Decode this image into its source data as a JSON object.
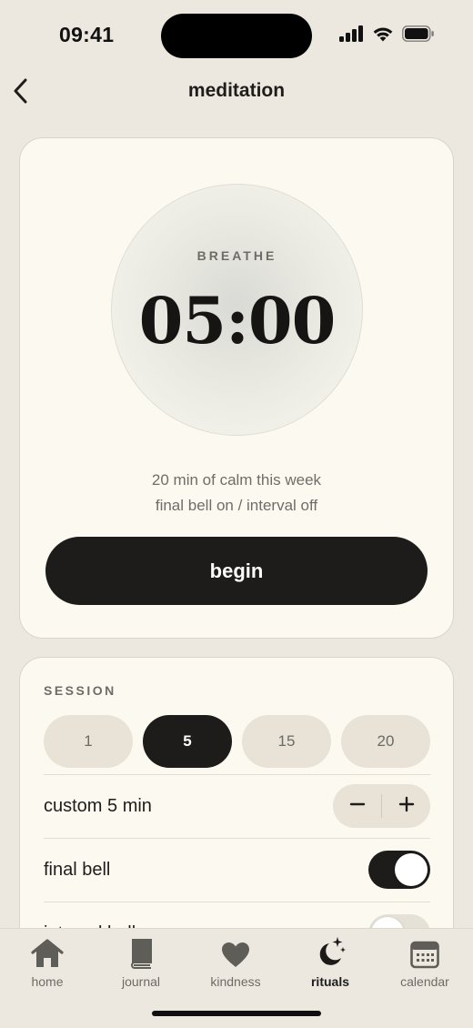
{
  "status_bar": {
    "time": "09:41"
  },
  "nav": {
    "title": "meditation",
    "back_icon": "chevron-left-icon"
  },
  "timer": {
    "label": "BREATHE",
    "value": "05:00",
    "stats": [
      "20 min of calm this week",
      "final bell on / interval off"
    ],
    "begin_label": "begin"
  },
  "session": {
    "section_label": "SESSION",
    "durations": [
      {
        "label": "1",
        "selected": false
      },
      {
        "label": "5",
        "selected": true
      },
      {
        "label": "15",
        "selected": false
      },
      {
        "label": "20",
        "selected": false
      }
    ],
    "custom": {
      "label": "custom 5 min",
      "decrement": "−",
      "increment": "+"
    },
    "final_bell": {
      "label": "final bell",
      "on": true
    },
    "interval_bell": {
      "label": "interval bell",
      "on": false
    }
  },
  "tabs": [
    {
      "label": "home",
      "icon": "house-icon",
      "active": false
    },
    {
      "label": "journal",
      "icon": "book-icon",
      "active": false
    },
    {
      "label": "kindness",
      "icon": "heart-icon",
      "active": false
    },
    {
      "label": "rituals",
      "icon": "moon-stars-icon",
      "active": true
    },
    {
      "label": "calendar",
      "icon": "calendar-icon",
      "active": false
    }
  ],
  "colors": {
    "background": "#ECE8DF",
    "card": "#FCFAF0",
    "accent_dark": "#1D1C1A",
    "chip": "#E8E3D6",
    "muted_text": "#6E6C66"
  }
}
